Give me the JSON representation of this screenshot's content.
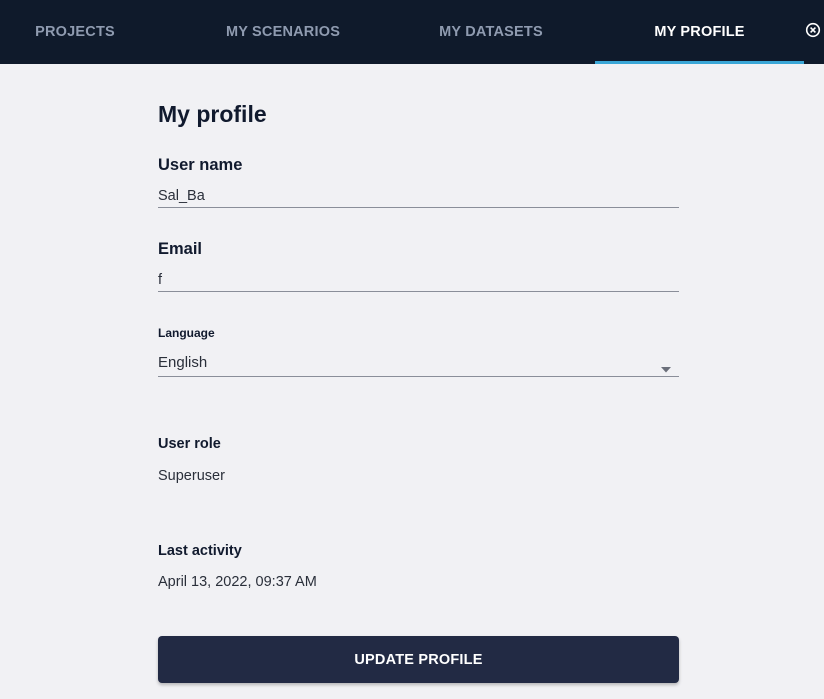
{
  "nav": {
    "tabs": [
      {
        "label": "PROJECTS",
        "active": false
      },
      {
        "label": "MY SCENARIOS",
        "active": false
      },
      {
        "label": "MY DATASETS",
        "active": false
      },
      {
        "label": "MY PROFILE",
        "active": true
      }
    ],
    "close_icon": "close-circle-icon"
  },
  "profile": {
    "title": "My profile",
    "username": {
      "label": "User name",
      "value": "Sal_Ba"
    },
    "email": {
      "label": "Email",
      "value": "f"
    },
    "language": {
      "label": "Language",
      "value": "English"
    },
    "role": {
      "label": "User role",
      "value": "Superuser"
    },
    "last_activity": {
      "label": "Last activity",
      "value": "April 13, 2022, 09:37 AM"
    },
    "update_button": "UPDATE PROFILE"
  },
  "colors": {
    "nav_bg": "#0f1a2b",
    "active_tab_indicator": "#3aa6d6",
    "page_bg": "#f1f1f4",
    "button_bg": "#222a44"
  }
}
